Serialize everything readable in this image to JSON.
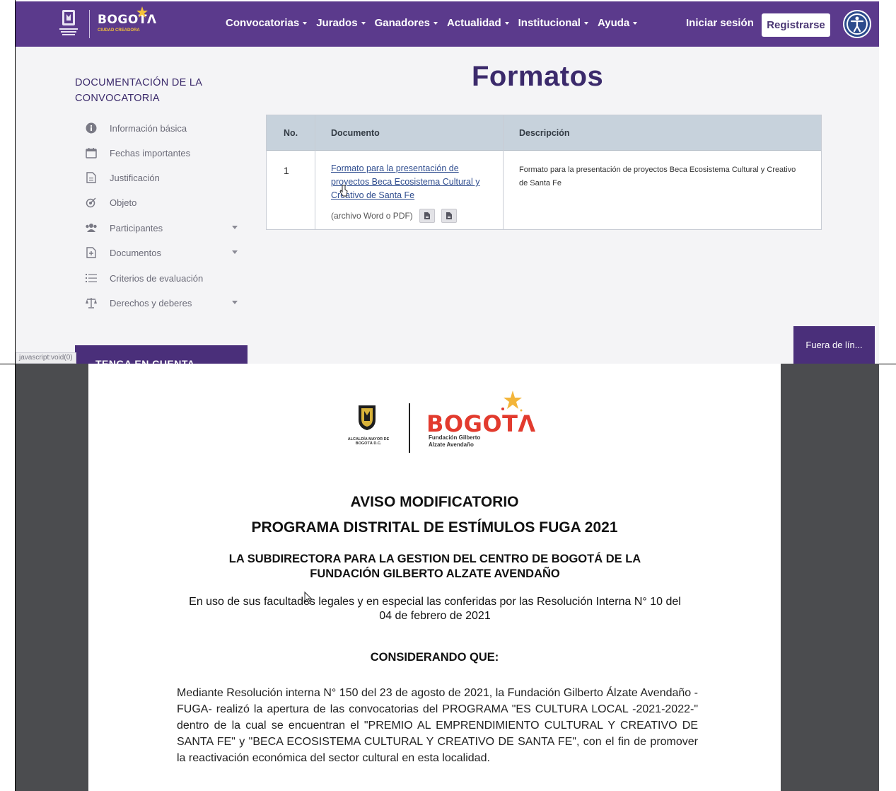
{
  "nav": {
    "brand": "BOGOTΛ",
    "brand_sub": "CIUDAD CREADORA",
    "items": [
      {
        "label": "Convocatorias"
      },
      {
        "label": "Jurados"
      },
      {
        "label": "Ganadores"
      },
      {
        "label": "Actualidad"
      },
      {
        "label": "Institucional"
      },
      {
        "label": "Ayuda"
      }
    ],
    "login": "Iniciar sesión",
    "register": "Registrarse"
  },
  "sidebar": {
    "title": "DOCUMENTACIÓN DE LA CONVOCATORIA",
    "items": [
      {
        "label": "Información básica",
        "icon": "info-icon"
      },
      {
        "label": "Fechas importantes",
        "icon": "calendar-icon"
      },
      {
        "label": "Justificación",
        "icon": "document-icon"
      },
      {
        "label": "Objeto",
        "icon": "target-icon"
      },
      {
        "label": "Participantes",
        "icon": "users-icon"
      },
      {
        "label": "Documentos",
        "icon": "file-plus-icon"
      },
      {
        "label": "Criterios de evaluación",
        "icon": "list-icon"
      },
      {
        "label": "Derechos y deberes",
        "icon": "scale-icon"
      }
    ],
    "tenga": "TENGA EN CUENTA"
  },
  "main": {
    "title": "Formatos",
    "table": {
      "headers": [
        "No.",
        "Documento",
        "Descripción"
      ],
      "rows": [
        {
          "no": "1",
          "doc_link": "Formato para la presentación de proyectos Beca Ecosistema Cultural y Creativo de Santa Fe",
          "doc_type": "(archivo Word o PDF)",
          "description": "Formato para la presentación de proyectos Beca Ecosistema Cultural y Creativo de Santa Fe"
        }
      ]
    }
  },
  "status_bar": "javascript:void(0)",
  "chat_button": "Fuera de lín...",
  "pdf": {
    "escudo_text": "ALCALDÍA MAYOR DE BOGOTÁ D.C.",
    "brand": "BOGOTΛ",
    "brand_sub": "Fundación Gilberto Alzate Avendaño",
    "title1": "AVISO MODIFICATORIO",
    "title2": "PROGRAMA DISTRITAL DE ESTÍMULOS FUGA 2021",
    "subtitle": "LA SUBDIRECTORA PARA LA GESTION DEL CENTRO DE BOGOTÁ DE LA FUNDACIÓN GILBERTO ALZATE AVENDAÑO",
    "intro": "En uso de sus facultades legales y en especial las conferidas por las Resolución Interna N° 10 del 04 de febrero de 2021",
    "considerando": "CONSIDERANDO QUE:",
    "body": "Mediante Resolución interna N° 150 del 23 de agosto de 2021, la Fundación Gilberto Álzate Avendaño -FUGA- realizó la apertura de las convocatorias del PROGRAMA \"ES CULTURA LOCAL -2021-2022-\" dentro de la cual se encuentran el \"PREMIO AL EMPRENDIMIENTO CULTURAL Y CREATIVO DE SANTA FE\" y \"BECA ECOSISTEMA CULTURAL Y CREATIVO DE SANTA FE\", con el fin de promover la reactivación económica del sector cultural en esta localidad."
  },
  "colors": {
    "nav_purple": "#5b3a8c",
    "heading_purple": "#3b2a6b",
    "pdf_red": "#e23b2e",
    "pdf_viewer_bg": "#4b4c4f"
  }
}
